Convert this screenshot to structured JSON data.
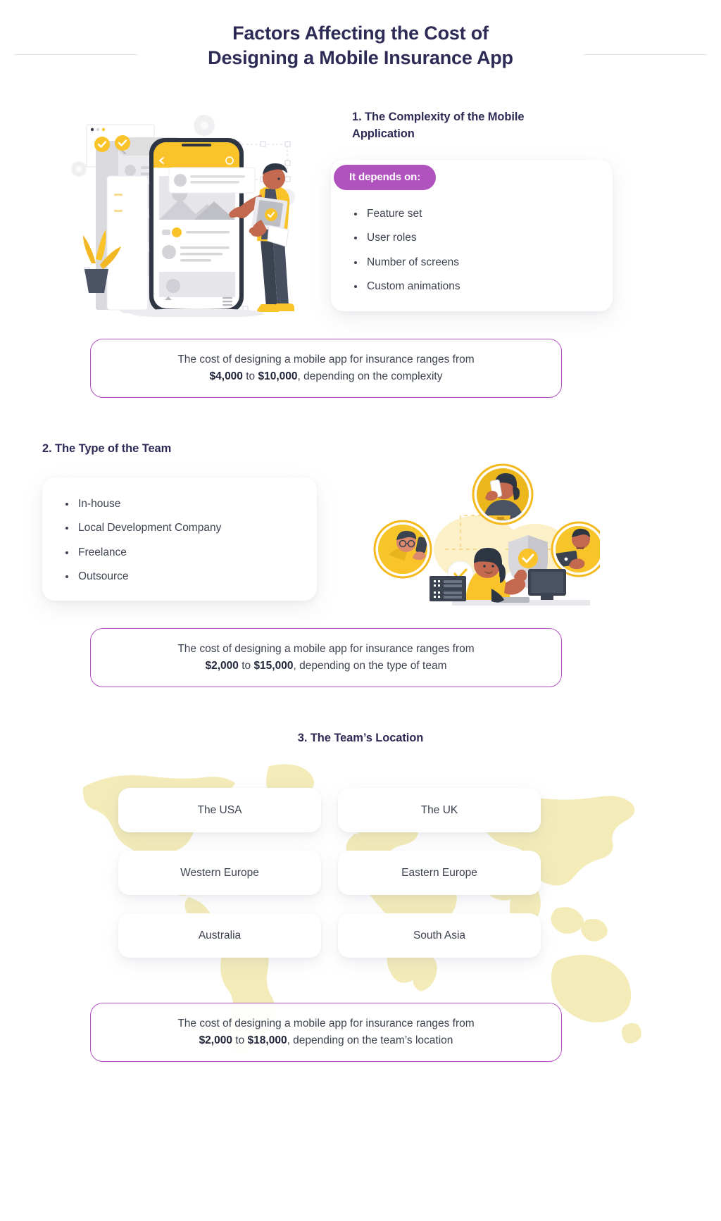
{
  "header": {
    "title_line1": "Factors Affecting the Cost of",
    "title_line2": "Designing a Mobile Insurance App"
  },
  "colors": {
    "title_navy": "#2d2b55",
    "badge_purple": "#b153bf",
    "cost_border": "#b153bf",
    "body_text": "#3d4250",
    "map_yellow": "#f3ecb9",
    "accent_yellow": "#f9c329"
  },
  "sections": [
    {
      "index": "1",
      "heading": "1. The Complexity of the Mobile Application",
      "badge": "It depends on:",
      "items": [
        "Feature set",
        "User roles",
        "Number of screens",
        "Custom animations"
      ],
      "cost": {
        "line1": "The cost of designing a mobile app for insurance ranges from",
        "amount_low": "$4,000",
        "joiner": " to ",
        "amount_high": "$10,000",
        "tail": ", depending on the complexity"
      }
    },
    {
      "index": "2",
      "heading": "2. The Type of the Team",
      "items": [
        "In-house",
        "Local Development Company",
        "Freelance",
        "Outsource"
      ],
      "cost": {
        "line1": "The cost of designing a mobile app for insurance ranges from",
        "amount_low": "$2,000",
        "joiner": " to ",
        "amount_high": "$15,000",
        "tail": ", depending on the type of team"
      }
    },
    {
      "index": "3",
      "heading": "3. The Team’s Location",
      "locations": [
        "The USA",
        "The UK",
        "Western Europe",
        "Eastern Europe",
        "Australia",
        "South Asia"
      ],
      "cost": {
        "line1": "The cost of designing a mobile app for insurance ranges from",
        "amount_low": "$2,000",
        "joiner": " to ",
        "amount_high": "$18,000",
        "tail": ", depending on the team’s location"
      }
    }
  ]
}
